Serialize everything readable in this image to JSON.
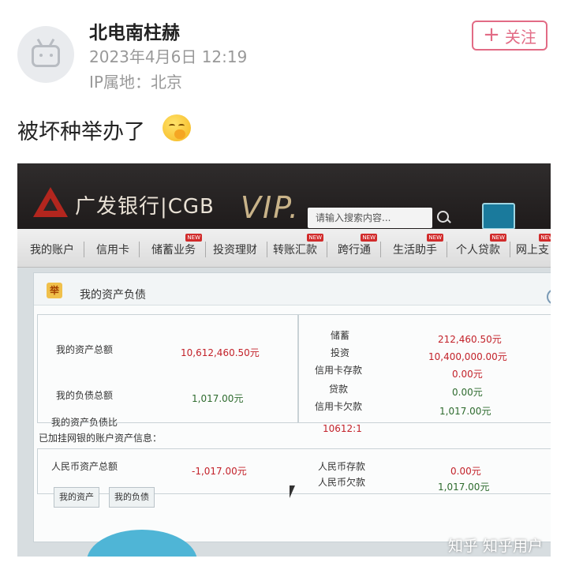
{
  "post": {
    "username": "北电南柱赫",
    "timestamp": "2023年4月6日 12:19",
    "ip_location": "IP属地：北京",
    "follow_label": "关注",
    "text": "被坏种举办了"
  },
  "bank": {
    "name": "广发银行|CGB",
    "vip_text": "VIP.",
    "search_placeholder": "请输入搜索内容...",
    "nav": [
      {
        "label": "我的账户",
        "new": false
      },
      {
        "label": "信用卡",
        "new": false
      },
      {
        "label": "储蓄业务",
        "new": true
      },
      {
        "label": "投资理财",
        "new": false
      },
      {
        "label": "转账汇款",
        "new": true
      },
      {
        "label": "跨行通",
        "new": true
      },
      {
        "label": "生活助手",
        "new": true
      },
      {
        "label": "个人贷款",
        "new": true
      },
      {
        "label": "网上支",
        "new": true
      }
    ],
    "new_badge": "NEW",
    "panel": {
      "icon_glyph": "举",
      "title": "我的资产负债",
      "total_assets_label": "我的资产总额",
      "total_assets_value": "10,612,460.50元",
      "total_liabilities_label": "我的负债总额",
      "total_liabilities_value": "1,017.00元",
      "ratio_label": "我的资产负债比",
      "ratio_value": "10612:1",
      "savings_label": "储蓄",
      "savings_value": "212,460.50元",
      "investment_label": "投资",
      "investment_value": "10,400,000.00元",
      "card_deposit_label": "信用卡存款",
      "card_deposit_value": "0.00元",
      "loan_label": "贷款",
      "loan_value": "0.00元",
      "card_debt_label": "信用卡欠款",
      "card_debt_value": "1,017.00元",
      "bound_info": "已加挂网银的账户资产信息：",
      "rmb_assets_label": "人民币资产总额",
      "rmb_assets_value": "-1,017.00元",
      "rmb_deposit_label": "人民币存款",
      "rmb_deposit_value": "0.00元",
      "rmb_debt_label": "人民币欠款",
      "rmb_debt_value": "1,017.00元",
      "tab_assets": "我的资产",
      "tab_liabilities": "我的负债"
    }
  },
  "watermark": "知乎 知乎用户"
}
